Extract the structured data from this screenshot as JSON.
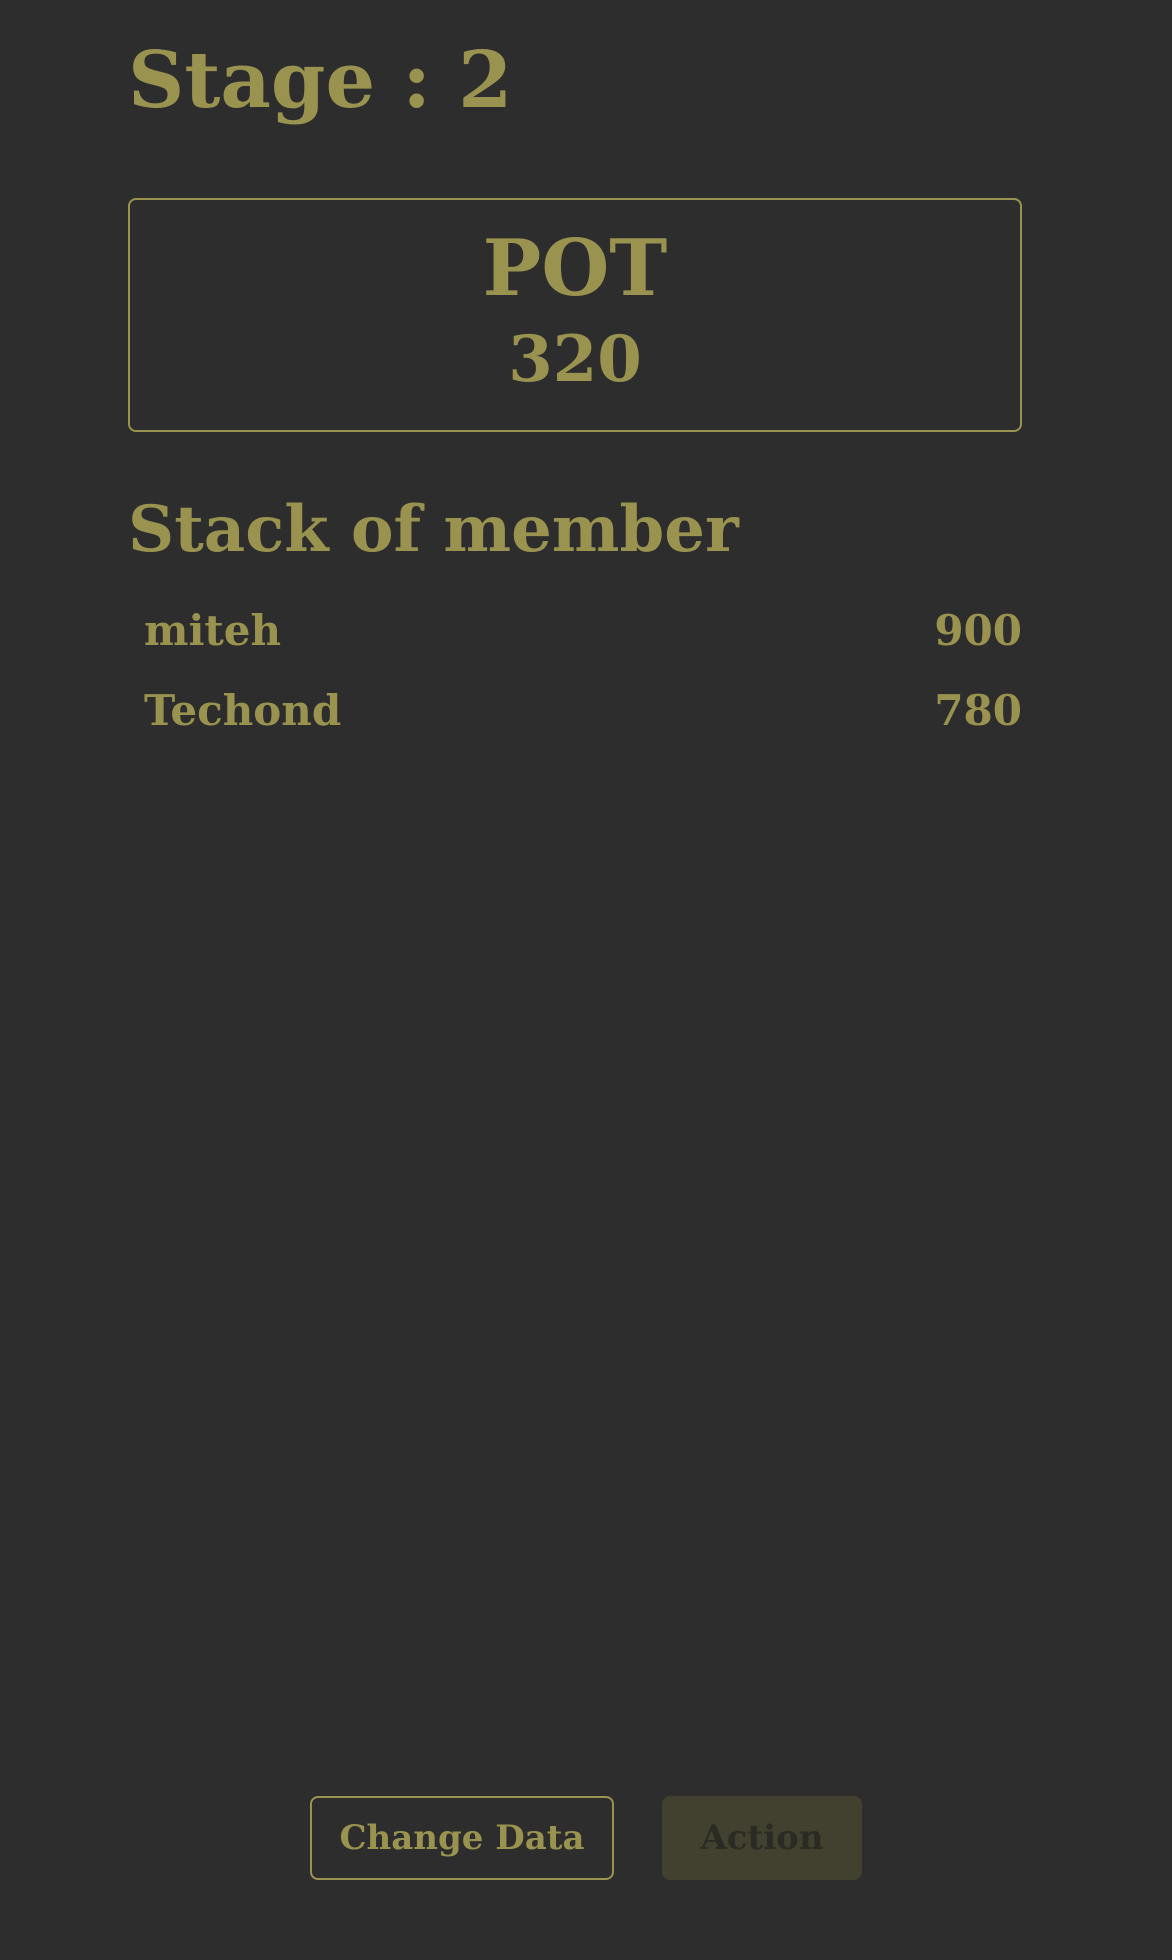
{
  "stage": {
    "title": "Stage : 2"
  },
  "pot": {
    "label": "POT",
    "value": "320"
  },
  "stack": {
    "title": "Stack of member",
    "members": [
      {
        "name": "miteh",
        "amount": "900"
      },
      {
        "name": "Techond",
        "amount": "780"
      }
    ]
  },
  "buttons": {
    "change_data": "Change Data",
    "action": "Action"
  },
  "colors": {
    "background": "#2d2d2d",
    "accent": "#9a9350",
    "disabled_button_bg": "#42402f"
  }
}
